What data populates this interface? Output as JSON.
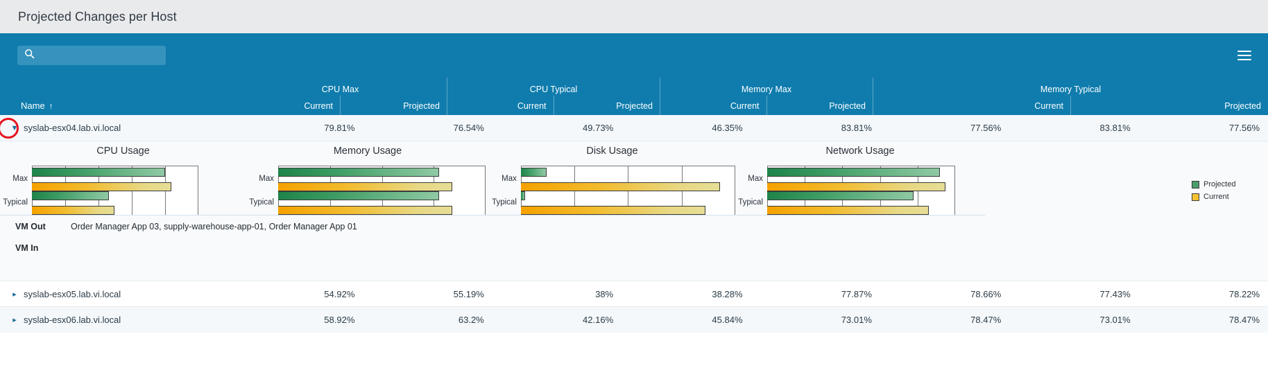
{
  "header": {
    "title": "Projected Changes per Host"
  },
  "toolbar": {
    "search_value": "",
    "search_placeholder": "",
    "search_icon": "search-icon",
    "menu_icon": "hamburger-menu-icon"
  },
  "table": {
    "name_column": {
      "label": "Name",
      "sort_indicator": "↑"
    },
    "groups": [
      {
        "label": "CPU Max",
        "sub": [
          "Current",
          "Projected"
        ]
      },
      {
        "label": "CPU Typical",
        "sub": [
          "Current",
          "Projected"
        ]
      },
      {
        "label": "Memory Max",
        "sub": [
          "Current",
          "Projected"
        ]
      },
      {
        "label": "Memory Typical",
        "sub": [
          "Current",
          "Projected"
        ]
      }
    ],
    "rows": [
      {
        "name": "syslab-esx04.lab.vi.local",
        "expanded": true,
        "chevron": "▼",
        "values": [
          "79.81%",
          "76.54%",
          "49.73%",
          "46.35%",
          "83.81%",
          "77.56%",
          "83.81%",
          "77.56%"
        ]
      },
      {
        "name": "syslab-esx05.lab.vi.local",
        "expanded": false,
        "chevron": "▸",
        "values": [
          "54.92%",
          "55.19%",
          "38%",
          "38.28%",
          "77.87%",
          "78.66%",
          "77.43%",
          "78.22%"
        ]
      },
      {
        "name": "syslab-esx06.lab.vi.local",
        "expanded": false,
        "chevron": "▸",
        "values": [
          "58.92%",
          "63.2%",
          "42.16%",
          "45.84%",
          "73.01%",
          "78.47%",
          "73.01%",
          "78.47%"
        ]
      }
    ]
  },
  "detail": {
    "legend": {
      "projected_label": "Projected",
      "current_label": "Current",
      "projected_color": "#4a9e6b",
      "current_color": "#f6c232"
    },
    "vm_out": {
      "label": "VM Out",
      "value": "Order Manager App 03, supply-warehouse-app-01, Order Manager App 01"
    },
    "vm_in": {
      "label": "VM In",
      "value": ""
    }
  },
  "chart_data": [
    {
      "type": "bar",
      "title": "CPU Usage",
      "categories": [
        "Max",
        "Typical"
      ],
      "series": [
        {
          "name": "Projected",
          "values": [
            79.8,
            46.4
          ]
        },
        {
          "name": "Current",
          "values": [
            83.8,
            49.7
          ]
        }
      ],
      "xlabel": "",
      "ylabel": "",
      "xlim": [
        0,
        100
      ],
      "gridlines": 5,
      "grid": true,
      "orientation": "horizontal",
      "legend_position": "right"
    },
    {
      "type": "bar",
      "title": "Memory Usage",
      "categories": [
        "Max",
        "Typical"
      ],
      "series": [
        {
          "name": "Projected",
          "values": [
            77.6,
            77.6
          ]
        },
        {
          "name": "Current",
          "values": [
            83.8,
            83.8
          ]
        }
      ],
      "xlabel": "",
      "ylabel": "",
      "xlim": [
        0,
        100
      ],
      "gridlines": 4,
      "grid": true,
      "orientation": "horizontal",
      "legend_position": "right"
    },
    {
      "type": "bar",
      "title": "Disk Usage",
      "categories": [
        "Max",
        "Typical"
      ],
      "series": [
        {
          "name": "Projected",
          "values": [
            12,
            2
          ]
        },
        {
          "name": "Current",
          "values": [
            93,
            86
          ]
        }
      ],
      "xlabel": "",
      "ylabel": "",
      "xlim": [
        0,
        100
      ],
      "gridlines": 4,
      "grid": true,
      "orientation": "horizontal",
      "legend_position": "right"
    },
    {
      "type": "bar",
      "title": "Network Usage",
      "categories": [
        "Max",
        "Typical"
      ],
      "series": [
        {
          "name": "Projected",
          "values": [
            92,
            78
          ]
        },
        {
          "name": "Current",
          "values": [
            95,
            86
          ]
        }
      ],
      "xlabel": "",
      "ylabel": "",
      "xlim": [
        0,
        100
      ],
      "gridlines": 5,
      "grid": true,
      "orientation": "horizontal",
      "legend_position": "right"
    }
  ]
}
